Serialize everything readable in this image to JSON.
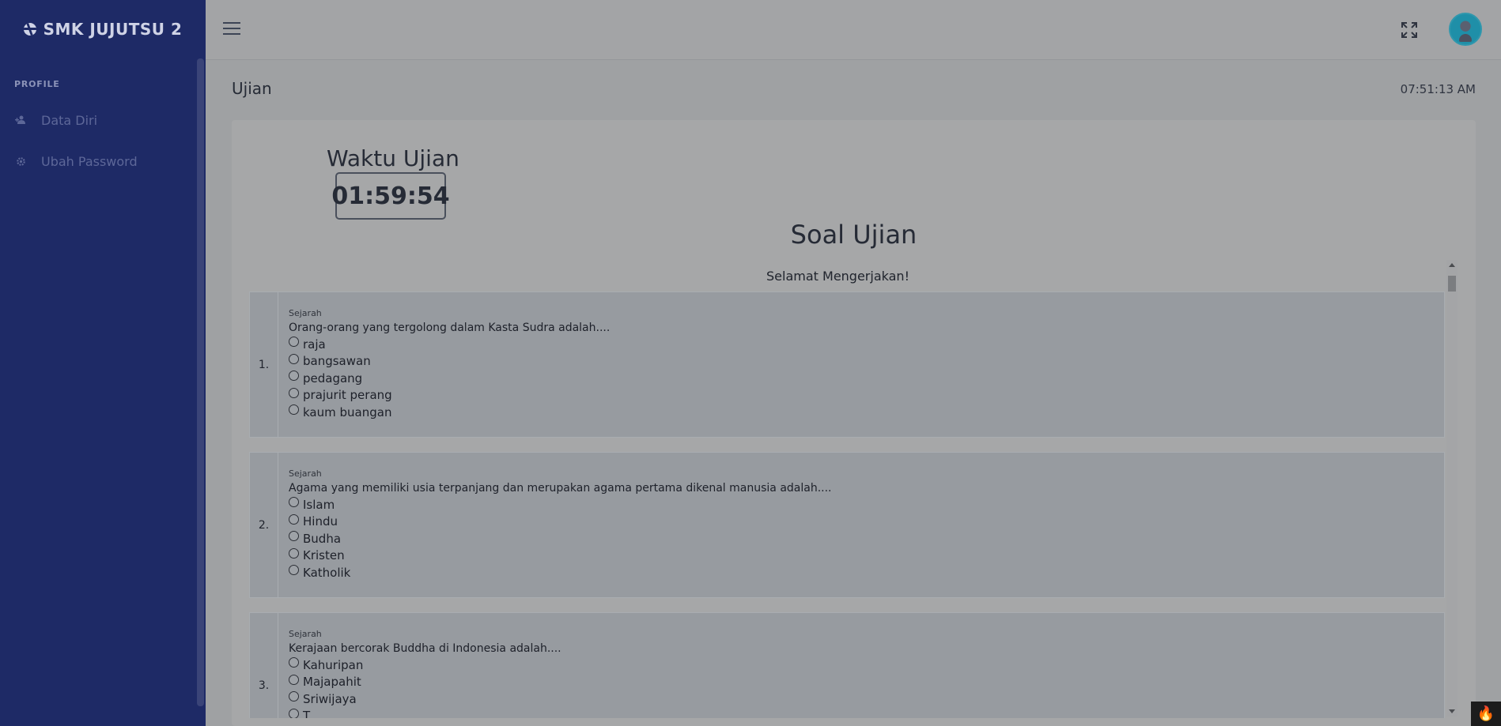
{
  "sidebar": {
    "brand": "SMK JUJUTSU 2",
    "heading": "PROFILE",
    "items": [
      {
        "label": "Data Diri",
        "icon": "user-plus-icon"
      },
      {
        "label": "Ubah Password",
        "icon": "gear-icon"
      }
    ]
  },
  "topbar": {
    "menu_icon": "hamburger-icon",
    "fullscreen_icon": "fullscreen-icon",
    "avatar": "astronaut-avatar"
  },
  "page": {
    "title": "Ujian",
    "clock": "07:51:13 AM"
  },
  "exam": {
    "timer_label": "Waktu Ujian",
    "timer": "01:59:54",
    "title": "Soal Ujian",
    "greeting": "Selamat Mengerjakan!",
    "questions": [
      {
        "number": "1.",
        "category": "Sejarah",
        "text": "Orang-orang yang tergolong dalam Kasta Sudra adalah....",
        "options": [
          "raja",
          "bangsawan",
          "pedagang",
          "prajurit perang",
          "kaum buangan"
        ]
      },
      {
        "number": "2.",
        "category": "Sejarah",
        "text": "Agama yang memiliki usia terpanjang dan merupakan agama pertama dikenal manusia adalah....",
        "options": [
          "Islam",
          "Hindu",
          "Budha",
          "Kristen",
          "Katholik"
        ]
      },
      {
        "number": "3.",
        "category": "Sejarah",
        "text": "Kerajaan bercorak Buddha di Indonesia adalah....",
        "options": [
          "Kahuripan",
          "Majapahit",
          "Sriwijaya",
          "T..."
        ]
      }
    ]
  },
  "colors": {
    "sidebar": "#1e2a66",
    "overlay_bg": "#9fa1a3"
  }
}
